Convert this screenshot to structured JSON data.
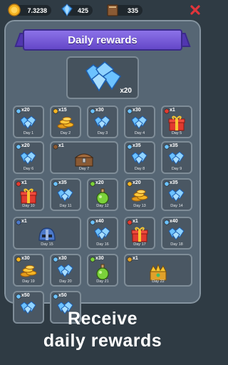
{
  "resources": {
    "coins": "7.3238",
    "gems": "425",
    "books": "335"
  },
  "title": "Daily rewards",
  "featured": {
    "qty": "x20",
    "icon": "gem-icon"
  },
  "days": [
    {
      "day": "Day 1",
      "qty": "x20",
      "icon": "gem"
    },
    {
      "day": "Day 2",
      "qty": "x15",
      "icon": "coin"
    },
    {
      "day": "Day 3",
      "qty": "x30",
      "icon": "gem"
    },
    {
      "day": "Day 4",
      "qty": "x30",
      "icon": "gem"
    },
    {
      "day": "Day 5",
      "qty": "x1",
      "icon": "gift"
    },
    {
      "day": "Day 6",
      "qty": "x20",
      "icon": "gem"
    },
    {
      "day": "Day 7",
      "qty": "x1",
      "icon": "chest"
    },
    {
      "day": "Day 8",
      "qty": "x35",
      "icon": "gem"
    },
    {
      "day": "Day 9",
      "qty": "x35",
      "icon": "gem"
    },
    {
      "day": "Day 10",
      "qty": "x1",
      "icon": "gift"
    },
    {
      "day": "Day 11",
      "qty": "x35",
      "icon": "gem"
    },
    {
      "day": "Day 12",
      "qty": "x20",
      "icon": "potion"
    },
    {
      "day": "Day 13",
      "qty": "x20",
      "icon": "coin"
    },
    {
      "day": "Day 14",
      "qty": "x35",
      "icon": "gem"
    },
    {
      "day": "Day 15",
      "qty": "x1",
      "icon": "helmet"
    },
    {
      "day": "Day 16",
      "qty": "x40",
      "icon": "gem"
    },
    {
      "day": "Day 17",
      "qty": "x1",
      "icon": "gift"
    },
    {
      "day": "Day 18",
      "qty": "x40",
      "icon": "gem"
    },
    {
      "day": "Day 19",
      "qty": "x30",
      "icon": "coin"
    },
    {
      "day": "Day 20",
      "qty": "x30",
      "icon": "gem"
    },
    {
      "day": "Day 21",
      "qty": "x30",
      "icon": "potion"
    },
    {
      "day": "Day 22",
      "qty": "x1",
      "icon": "crown-chest"
    },
    {
      "day": "",
      "qty": "x50",
      "icon": "gem"
    },
    {
      "day": "",
      "qty": "x50",
      "icon": "gem"
    }
  ],
  "caption": {
    "line1": "Receive",
    "line2": "daily rewards"
  },
  "colors": {
    "panel": "#566674",
    "banner": "#7a5de0",
    "background": "#2f3b44",
    "close": "#e0353b"
  }
}
